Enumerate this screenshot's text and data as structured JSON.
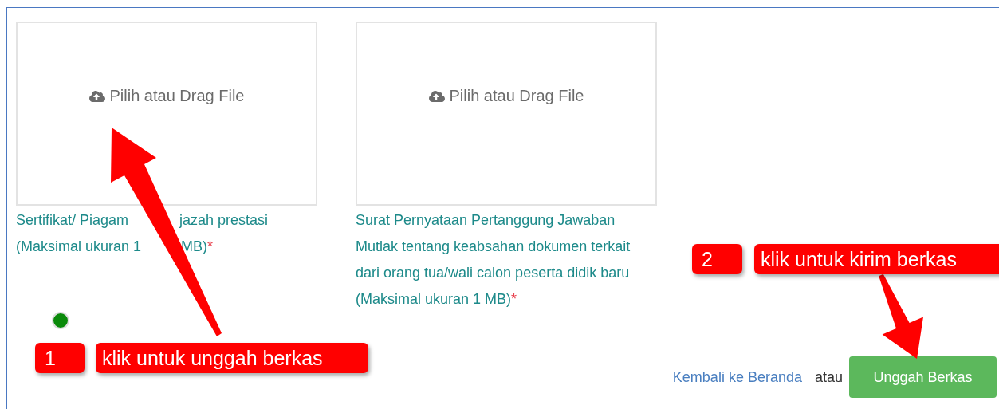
{
  "uploads": [
    {
      "prompt": "Pilih atau Drag File",
      "label_segments": [
        "Sertifikat/ Piagam",
        "jazah prestasi",
        "(Maksimal ukuran 1",
        "MB)"
      ],
      "required_mark": "*"
    },
    {
      "prompt": "Pilih atau Drag File",
      "label": "Surat Pernyataan Pertanggung Jawaban Mutlak tentang keabsahan dokumen terkait dari orang tua/wali calon peserta didik baru (Maksimal ukuran 1 MB)",
      "required_mark": "*"
    }
  ],
  "footer": {
    "back_link": "Kembali ke Beranda",
    "separator": "atau",
    "submit_button": "Unggah Berkas"
  },
  "annotations": [
    {
      "number": "1",
      "text": "klik untuk unggah berkas"
    },
    {
      "number": "2",
      "text": "klik untuk kirim berkas"
    }
  ]
}
